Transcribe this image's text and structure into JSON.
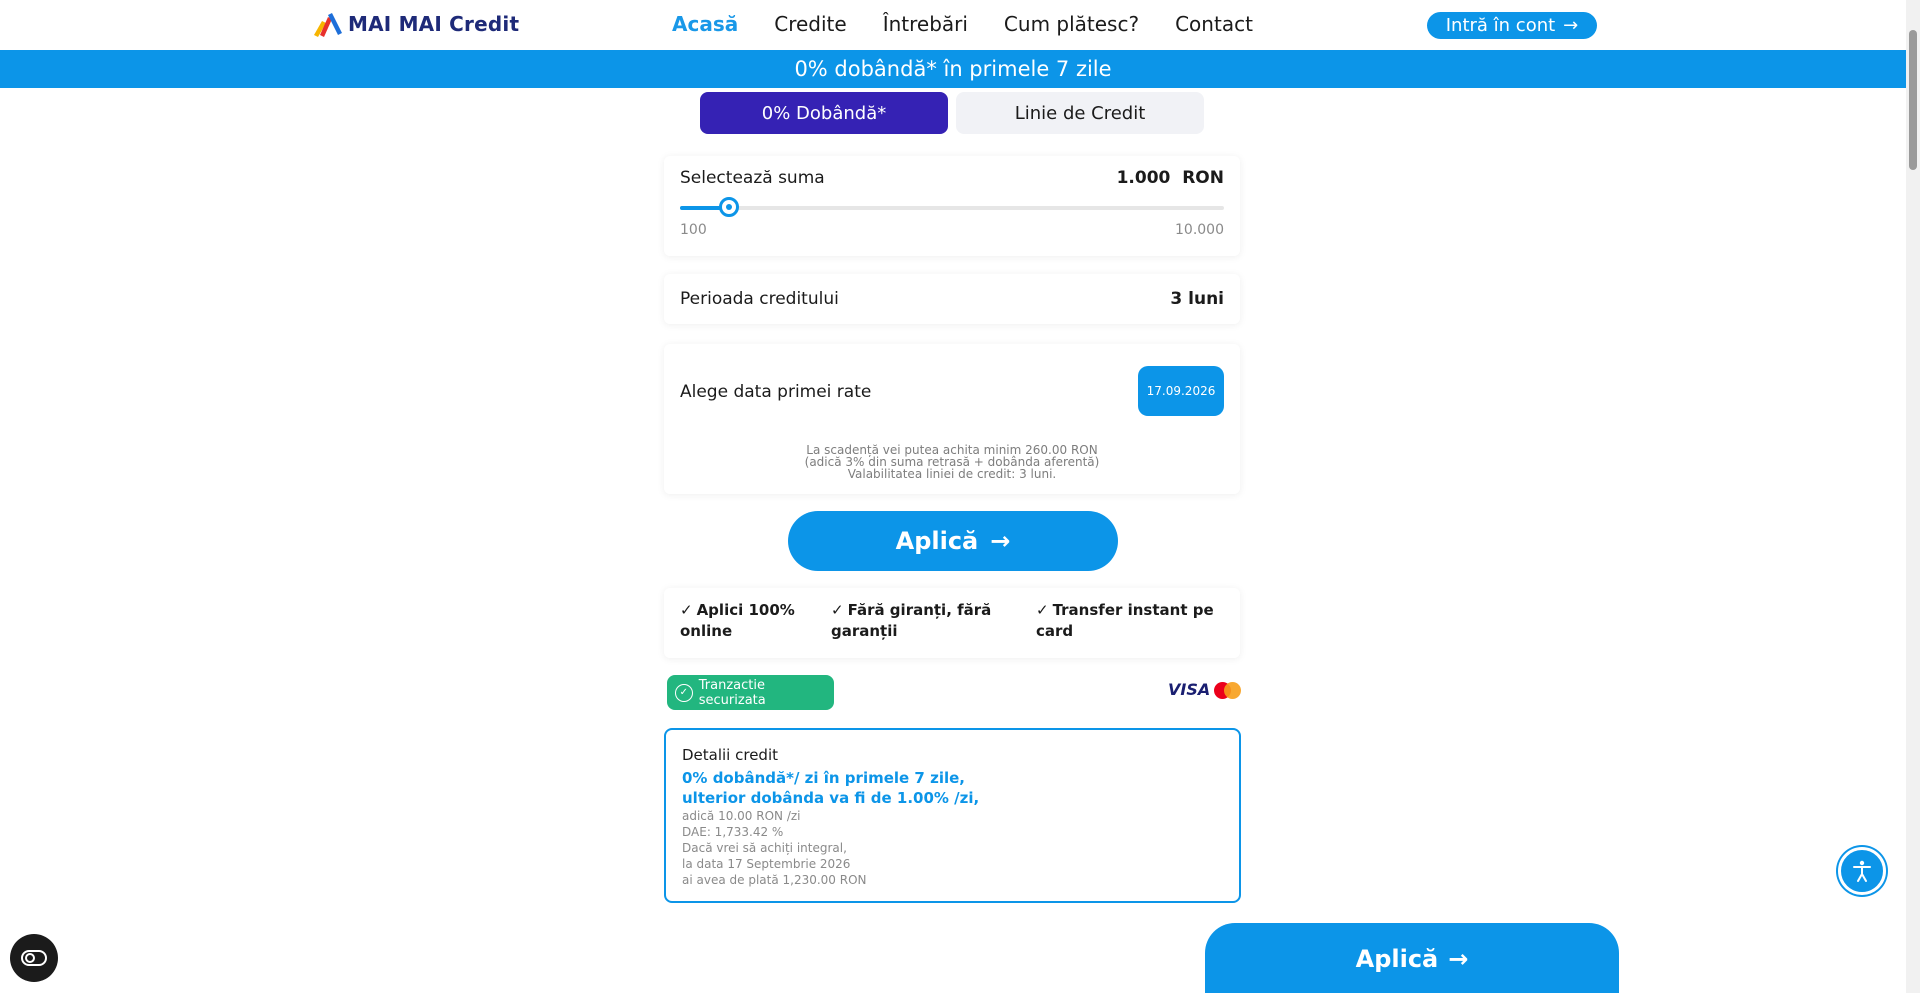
{
  "header": {
    "logo_text": "MAI MAI Credit",
    "nav": [
      {
        "label": "Acasă"
      },
      {
        "label": "Credite"
      },
      {
        "label": "Întrebări"
      },
      {
        "label": "Cum plătesc?"
      },
      {
        "label": "Contact"
      }
    ],
    "login_label": "Intră în cont"
  },
  "promo": "0% dobândă* în primele 7 zile",
  "tabs": [
    {
      "label": "0% Dobândă*"
    },
    {
      "label": "Linie de Credit"
    }
  ],
  "amount": {
    "label": "Selectează suma",
    "value": "1.000",
    "currency": "RON",
    "min": "100",
    "max": "10.000",
    "fraction": 0.0909
  },
  "period": {
    "label": "Perioada creditului",
    "value": "3 luni"
  },
  "first_rate": {
    "label": "Alege data primei rate",
    "date": "17.09.2026",
    "note": [
      "La scadență vei putea achita minim 260.00 RON",
      "(adică 3% din suma retrasă + dobânda aferentă)",
      "Valabilitatea liniei de credit: 3 luni."
    ]
  },
  "apply_label": "Aplică",
  "features": [
    {
      "line1": "Aplici 100%",
      "line2": "online"
    },
    {
      "line1": "Fără giranți, fără",
      "line2": "garanții"
    },
    {
      "line1": "Transfer instant pe",
      "line2": "card"
    }
  ],
  "secure_label": "Tranzactie securizata",
  "visa_label": "VISA",
  "details": {
    "title": "Detalii credit",
    "highlight1": "0% dobândă*/ zi în primele 7 zile,",
    "highlight2": "ulterior dobânda va fi de 1.00% /zi,",
    "lines": [
      "adică 10.00 RON /zi",
      "DAE: 1,733.42 %",
      "Dacă vrei să achiți integral,",
      "la data 17 Septembrie 2026",
      "ai avea de plată 1,230.00 RON"
    ]
  },
  "colors": {
    "primary": "#0c95e8",
    "tab_active": "#3522b4",
    "secure": "#22b67f",
    "logo": "#1e2a78"
  }
}
